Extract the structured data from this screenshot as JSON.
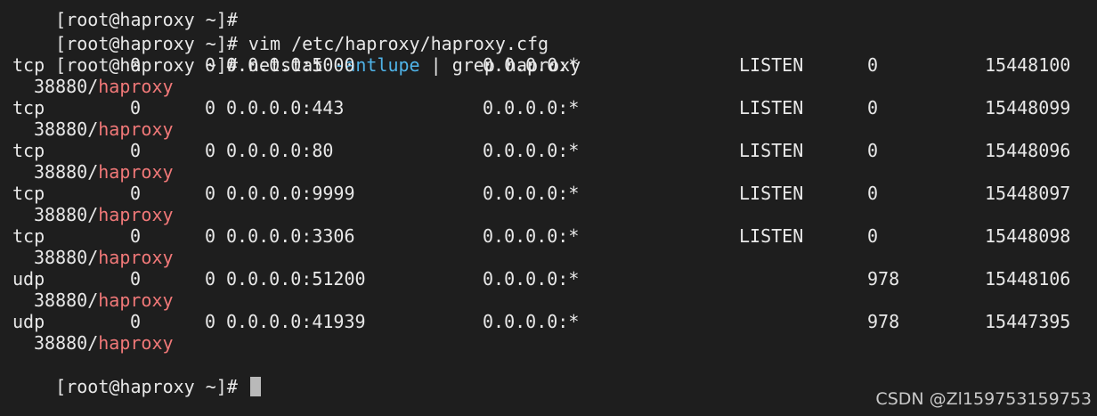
{
  "terminal": {
    "prev_prompt": "[root@haproxy ~]#",
    "cmd1": {
      "prompt": "[root@haproxy ~]#",
      "text": " vim /etc/haproxy/haproxy.cfg"
    },
    "cmd2": {
      "prompt": "[root@haproxy ~]#",
      "cmd": " netstat ",
      "flag": "-antlupe",
      "rest": " | grep haproxy"
    },
    "rows": [
      {
        "proto": "tcp",
        "recvq": "0",
        "sendq": "0",
        "local": "0.0.0.0:5000",
        "foreign": "0.0.0.0:*",
        "state": "LISTEN",
        "user": "0",
        "inode": "15448100",
        "pid": "38880/",
        "prog": "haproxy"
      },
      {
        "proto": "tcp",
        "recvq": "0",
        "sendq": "0",
        "local": "0.0.0.0:443",
        "foreign": "0.0.0.0:*",
        "state": "LISTEN",
        "user": "0",
        "inode": "15448099",
        "pid": "38880/",
        "prog": "haproxy"
      },
      {
        "proto": "tcp",
        "recvq": "0",
        "sendq": "0",
        "local": "0.0.0.0:80",
        "foreign": "0.0.0.0:*",
        "state": "LISTEN",
        "user": "0",
        "inode": "15448096",
        "pid": "38880/",
        "prog": "haproxy"
      },
      {
        "proto": "tcp",
        "recvq": "0",
        "sendq": "0",
        "local": "0.0.0.0:9999",
        "foreign": "0.0.0.0:*",
        "state": "LISTEN",
        "user": "0",
        "inode": "15448097",
        "pid": "38880/",
        "prog": "haproxy"
      },
      {
        "proto": "tcp",
        "recvq": "0",
        "sendq": "0",
        "local": "0.0.0.0:3306",
        "foreign": "0.0.0.0:*",
        "state": "LISTEN",
        "user": "0",
        "inode": "15448098",
        "pid": "38880/",
        "prog": "haproxy"
      },
      {
        "proto": "udp",
        "recvq": "0",
        "sendq": "0",
        "local": "0.0.0.0:51200",
        "foreign": "0.0.0.0:*",
        "state": "",
        "user": "978",
        "inode": "15448106",
        "pid": "38880/",
        "prog": "haproxy"
      },
      {
        "proto": "udp",
        "recvq": "0",
        "sendq": "0",
        "local": "0.0.0.0:41939",
        "foreign": "0.0.0.0:*",
        "state": "",
        "user": "978",
        "inode": "15447395",
        "pid": "38880/",
        "prog": "haproxy"
      }
    ],
    "final_prompt": "[root@haproxy ~]#"
  },
  "watermark": "CSDN @Zl159753159753",
  "colors": {
    "background": "#1e1e1e",
    "text": "#e8e8e8",
    "flag": "#4fb3e8",
    "program": "#f07878",
    "cursor": "#b9b9b9"
  }
}
